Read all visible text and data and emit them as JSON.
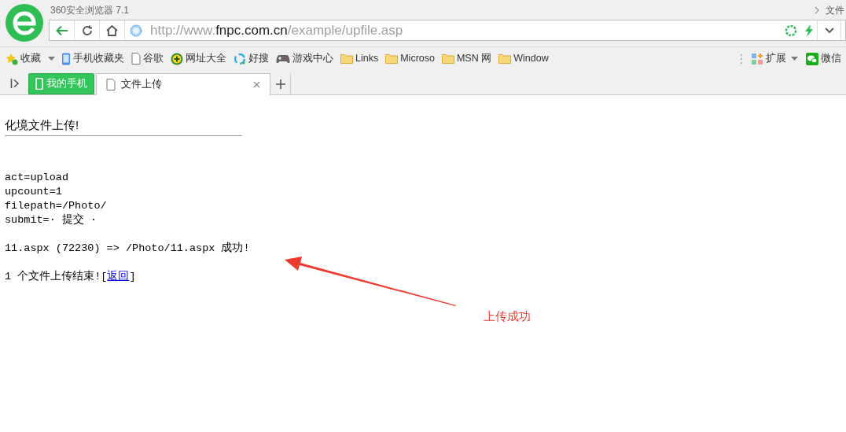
{
  "window": {
    "title": "360安全浏览器 7.1",
    "top_right_text": "文件"
  },
  "address_bar": {
    "url_prefix": "http://www.",
    "url_host": "fnpc.com.cn",
    "url_path": "/example/upfile.asp"
  },
  "bookmarks": [
    {
      "kind": "star",
      "label": "收藏"
    },
    {
      "kind": "phone",
      "label": "手机收藏夹"
    },
    {
      "kind": "page",
      "label": "谷歌"
    },
    {
      "kind": "plus",
      "label": "网址大全"
    },
    {
      "kind": "ring",
      "label": "好搜"
    },
    {
      "kind": "gamepad",
      "label": "游戏中心"
    },
    {
      "kind": "folder",
      "label": "Links"
    },
    {
      "kind": "folder",
      "label": "Microso"
    },
    {
      "kind": "folder",
      "label": "MSN 网"
    },
    {
      "kind": "folder",
      "label": "Window"
    }
  ],
  "toolbar_right": [
    {
      "kind": "extensions",
      "label": "扩展"
    },
    {
      "kind": "wechat",
      "label": "微信"
    }
  ],
  "tabs": [
    {
      "kind": "phone",
      "label": "我的手机",
      "selected": false
    },
    {
      "kind": "page",
      "label": "文件上传",
      "selected": true
    }
  ],
  "page": {
    "heading": "化境文件上传!",
    "params": [
      "act=upload",
      "upcount=1",
      "filepath=/Photo/",
      "submit=· 提交 ·"
    ],
    "result": "11.aspx (72230) => /Photo/11.aspx 成功!",
    "summary": "1 个文件上传结束![",
    "link": "返回",
    "summary_end": "]"
  },
  "annotation": {
    "label": "上传成功"
  }
}
